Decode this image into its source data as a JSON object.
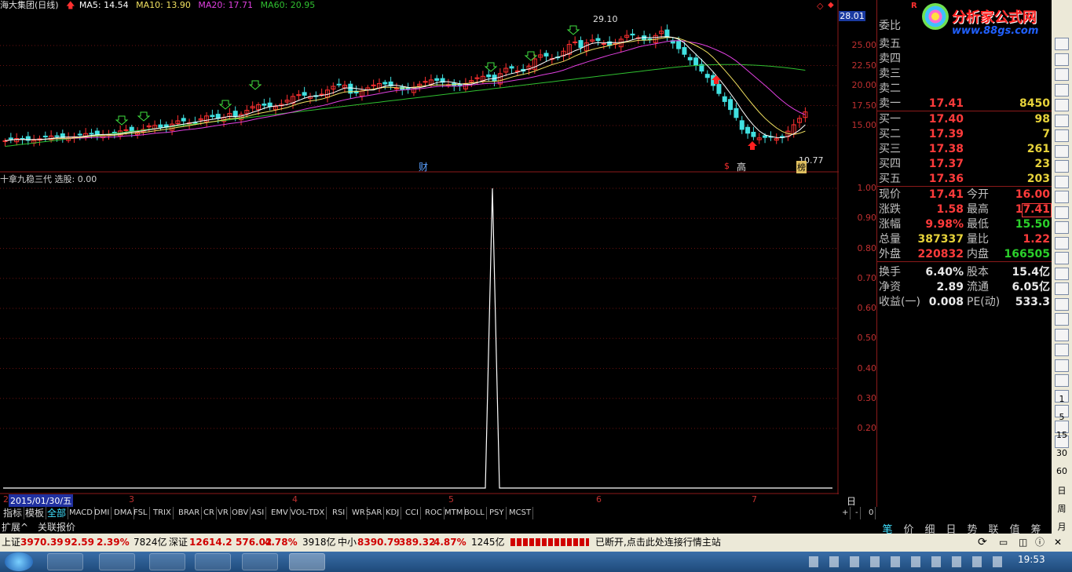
{
  "header": {
    "stock": "海大集团(日线)",
    "ma5": "MA5: 14.54",
    "ma10": "MA10: 13.90",
    "ma20": "MA20: 17.71",
    "ma60": "MA60: 20.95",
    "current_price_tag": "28.01"
  },
  "colors": {
    "ma5": "#ffffff",
    "ma10": "#f0e060",
    "ma20": "#e040e0",
    "ma60": "#30c030",
    "up": "#ff3030",
    "down": "#40e0e0"
  },
  "price_axis": [
    "25.00",
    "22.50",
    "20.00",
    "17.50",
    "15.00"
  ],
  "annotations": {
    "high": "29.10",
    "low": "10.77",
    "cai": "财",
    "gao": "高",
    "bang": "榜",
    "dollar": "$"
  },
  "indicator": {
    "title": "十拿九稳三代 选股: 0.00",
    "axis": [
      "1.00",
      "0.90",
      "0.80",
      "0.70",
      "0.60",
      "0.50",
      "0.40",
      "0.30",
      "0.20"
    ]
  },
  "date_axis": {
    "selected": "2015/01/30/五",
    "months": [
      "2",
      "3",
      "4",
      "5",
      "6",
      "7"
    ],
    "period": "日线"
  },
  "quote": {
    "weibi": "委比",
    "sell": [
      {
        "label": "卖五",
        "price": "",
        "vol": ""
      },
      {
        "label": "卖四",
        "price": "",
        "vol": ""
      },
      {
        "label": "卖三",
        "price": "",
        "vol": ""
      },
      {
        "label": "卖二",
        "price": "",
        "vol": ""
      },
      {
        "label": "卖一",
        "price": "17.41",
        "vol": "8450"
      }
    ],
    "buy": [
      {
        "label": "买一",
        "price": "17.40",
        "vol": "98"
      },
      {
        "label": "买二",
        "price": "17.39",
        "vol": "7"
      },
      {
        "label": "买三",
        "price": "17.38",
        "vol": "261"
      },
      {
        "label": "买四",
        "price": "17.37",
        "vol": "23"
      },
      {
        "label": "买五",
        "price": "17.36",
        "vol": "203"
      }
    ],
    "stats": [
      {
        "k": "现价",
        "v": "17.41",
        "k2": "今开",
        "v2": "16.00",
        "c": "red",
        "c2": "red"
      },
      {
        "k": "涨跌",
        "v": "1.58",
        "k2": "最高",
        "v2": "17.41",
        "c": "red",
        "c2": "red"
      },
      {
        "k": "涨幅",
        "v": "9.98%",
        "k2": "最低",
        "v2": "15.50",
        "c": "red",
        "c2": "green"
      },
      {
        "k": "总量",
        "v": "387337",
        "k2": "量比",
        "v2": "1.22",
        "c": "yellow",
        "c2": "red"
      },
      {
        "k": "外盘",
        "v": "220832",
        "k2": "内盘",
        "v2": "166505",
        "c": "red",
        "c2": "green"
      },
      {
        "k": "换手",
        "v": "6.40%",
        "k2": "股本",
        "v2": "15.4亿",
        "c": "white",
        "c2": "white"
      },
      {
        "k": "净资",
        "v": "2.89",
        "k2": "流通",
        "v2": "6.05亿",
        "c": "white",
        "c2": "white"
      },
      {
        "k": "收益(一)",
        "v": "0.008",
        "k2": "PE(动)",
        "v2": "533.3",
        "c": "white",
        "c2": "white"
      }
    ]
  },
  "tabs": [
    "指标",
    "模板",
    "全部",
    "MACD",
    "DMI",
    "DMA",
    "FSL",
    "TRIX",
    "BRAR",
    "CR",
    "VR",
    "OBV",
    "ASI",
    "EMV",
    "VOL-TDX",
    "RSI",
    "WR",
    "SAR",
    "KDJ",
    "CCI",
    "ROC",
    "MTM",
    "BOLL",
    "PSY",
    "MCST"
  ],
  "tab_controls": [
    "+",
    "-",
    "0"
  ],
  "row2": [
    "扩展^",
    "关联报价"
  ],
  "right_tabs": [
    "笔",
    "价",
    "细",
    "日",
    "势",
    "联",
    "值",
    "筹"
  ],
  "toolbar_nums": [
    "1",
    "5",
    "15",
    "30",
    "60",
    "日",
    "周",
    "月"
  ],
  "status": {
    "sh_label": "上证",
    "sh_val": "3970.39",
    "sh_chg": "92.59",
    "sh_pct": "2.39%",
    "sh_amt": "7824亿",
    "sz_label": "深证",
    "sz_val": "12614.2",
    "sz_chg": "576.02",
    "sz_pct": "4.78%",
    "sz_amt": "3918亿",
    "zx_label": "中小",
    "zx_val": "8390.79",
    "zx_chg": "389.32",
    "zx_pct": "4.87%",
    "zx_amt": "1245亿",
    "msg": "已断开,点击此处连接行情主站"
  },
  "brand": {
    "name": "分析家公式网",
    "url": "www.88gs.com"
  },
  "clock": {
    "time": "19:53"
  }
}
